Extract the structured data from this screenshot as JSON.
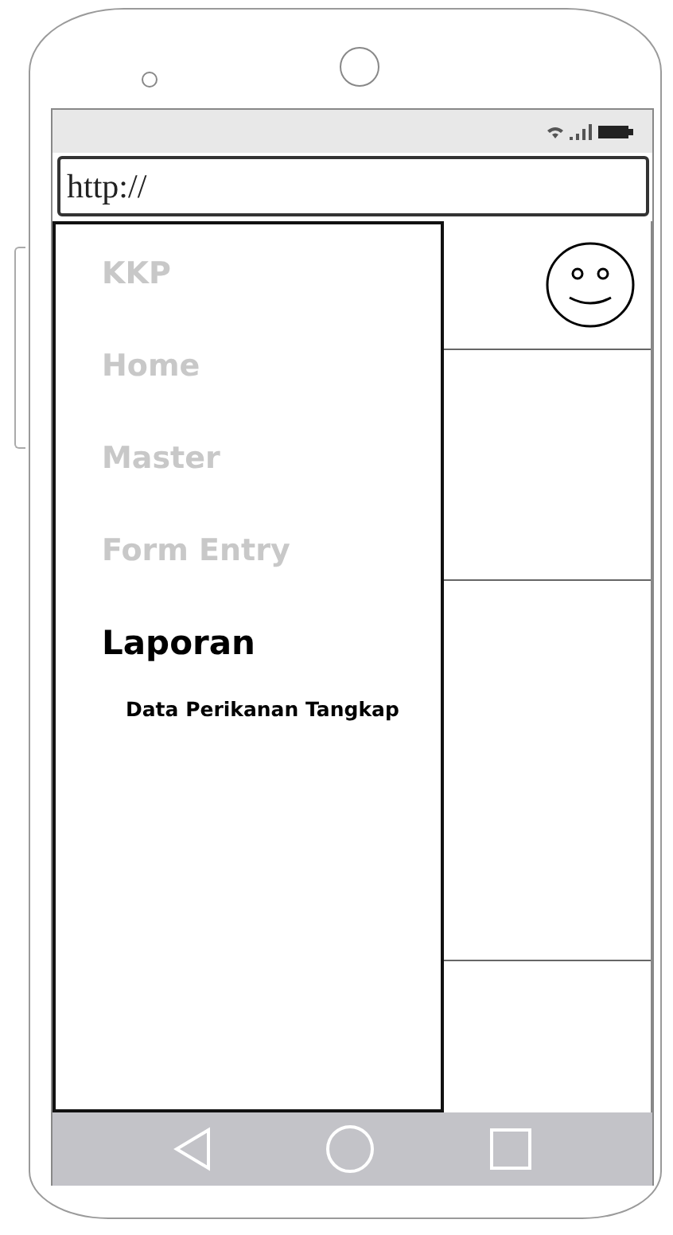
{
  "address_bar": {
    "value": "http://"
  },
  "menu": {
    "items": [
      {
        "label": "KKP",
        "selected": false
      },
      {
        "label": "Home",
        "selected": false
      },
      {
        "label": "Master",
        "selected": false
      },
      {
        "label": "Form Entry",
        "selected": false
      },
      {
        "label": "Laporan",
        "selected": true,
        "children": [
          {
            "label": "Data Perikanan Tangkap"
          }
        ]
      }
    ]
  }
}
